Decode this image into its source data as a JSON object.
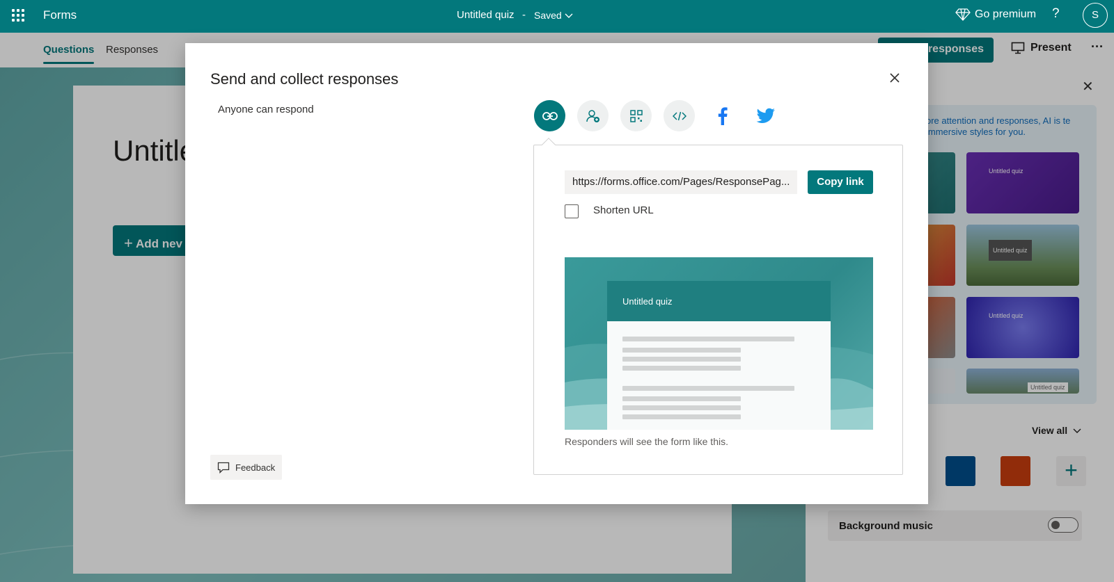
{
  "topbar": {
    "app_name": "Forms",
    "doc_title": "Untitled quiz",
    "doc_separator": "-",
    "doc_status": "Saved",
    "premium_label": "Go premium",
    "help_label": "?",
    "avatar_initial": "S"
  },
  "subbar": {
    "tabs": [
      {
        "label": "Questions",
        "active": true
      },
      {
        "label": "Responses",
        "active": false
      }
    ],
    "collect_label": "responses",
    "present_label": "Present",
    "more_label": "···"
  },
  "background": {
    "form_title": "Untitle",
    "add_new_label": "Add nev"
  },
  "side_panel": {
    "ai_text": "ore attention and responses, AI is te immersive styles for you.",
    "themes": [
      {
        "label": "Untitled quiz"
      },
      {
        "label": "Untitled quiz"
      },
      {
        "label": "Untitled quiz"
      },
      {
        "label": "Untitled quiz"
      }
    ],
    "view_all_label": "View all",
    "swatch_colors": [
      "#004e8c",
      "#ca3d0f"
    ],
    "add_swatch_label": "+",
    "music_label": "Background music",
    "music_enabled": false
  },
  "modal": {
    "title": "Send and collect responses",
    "audience": "Anyone can respond",
    "share_options": [
      {
        "icon": "link-icon",
        "active": true
      },
      {
        "icon": "person-add-icon",
        "active": false
      },
      {
        "icon": "qr-code-icon",
        "active": false
      },
      {
        "icon": "embed-code-icon",
        "active": false
      },
      {
        "icon": "facebook-icon",
        "active": false
      },
      {
        "icon": "twitter-icon",
        "active": false
      }
    ],
    "link_value": "https://forms.office.com/Pages/ResponsePag...",
    "copy_label": "Copy link",
    "shorten_label": "Shorten URL",
    "shorten_checked": false,
    "preview_title": "Untitled quiz",
    "preview_caption": "Responders will see the form like this.",
    "feedback_label": "Feedback"
  },
  "colors": {
    "brand": "#03787c",
    "facebook": "#1877f2",
    "twitter": "#1d9bf0"
  }
}
